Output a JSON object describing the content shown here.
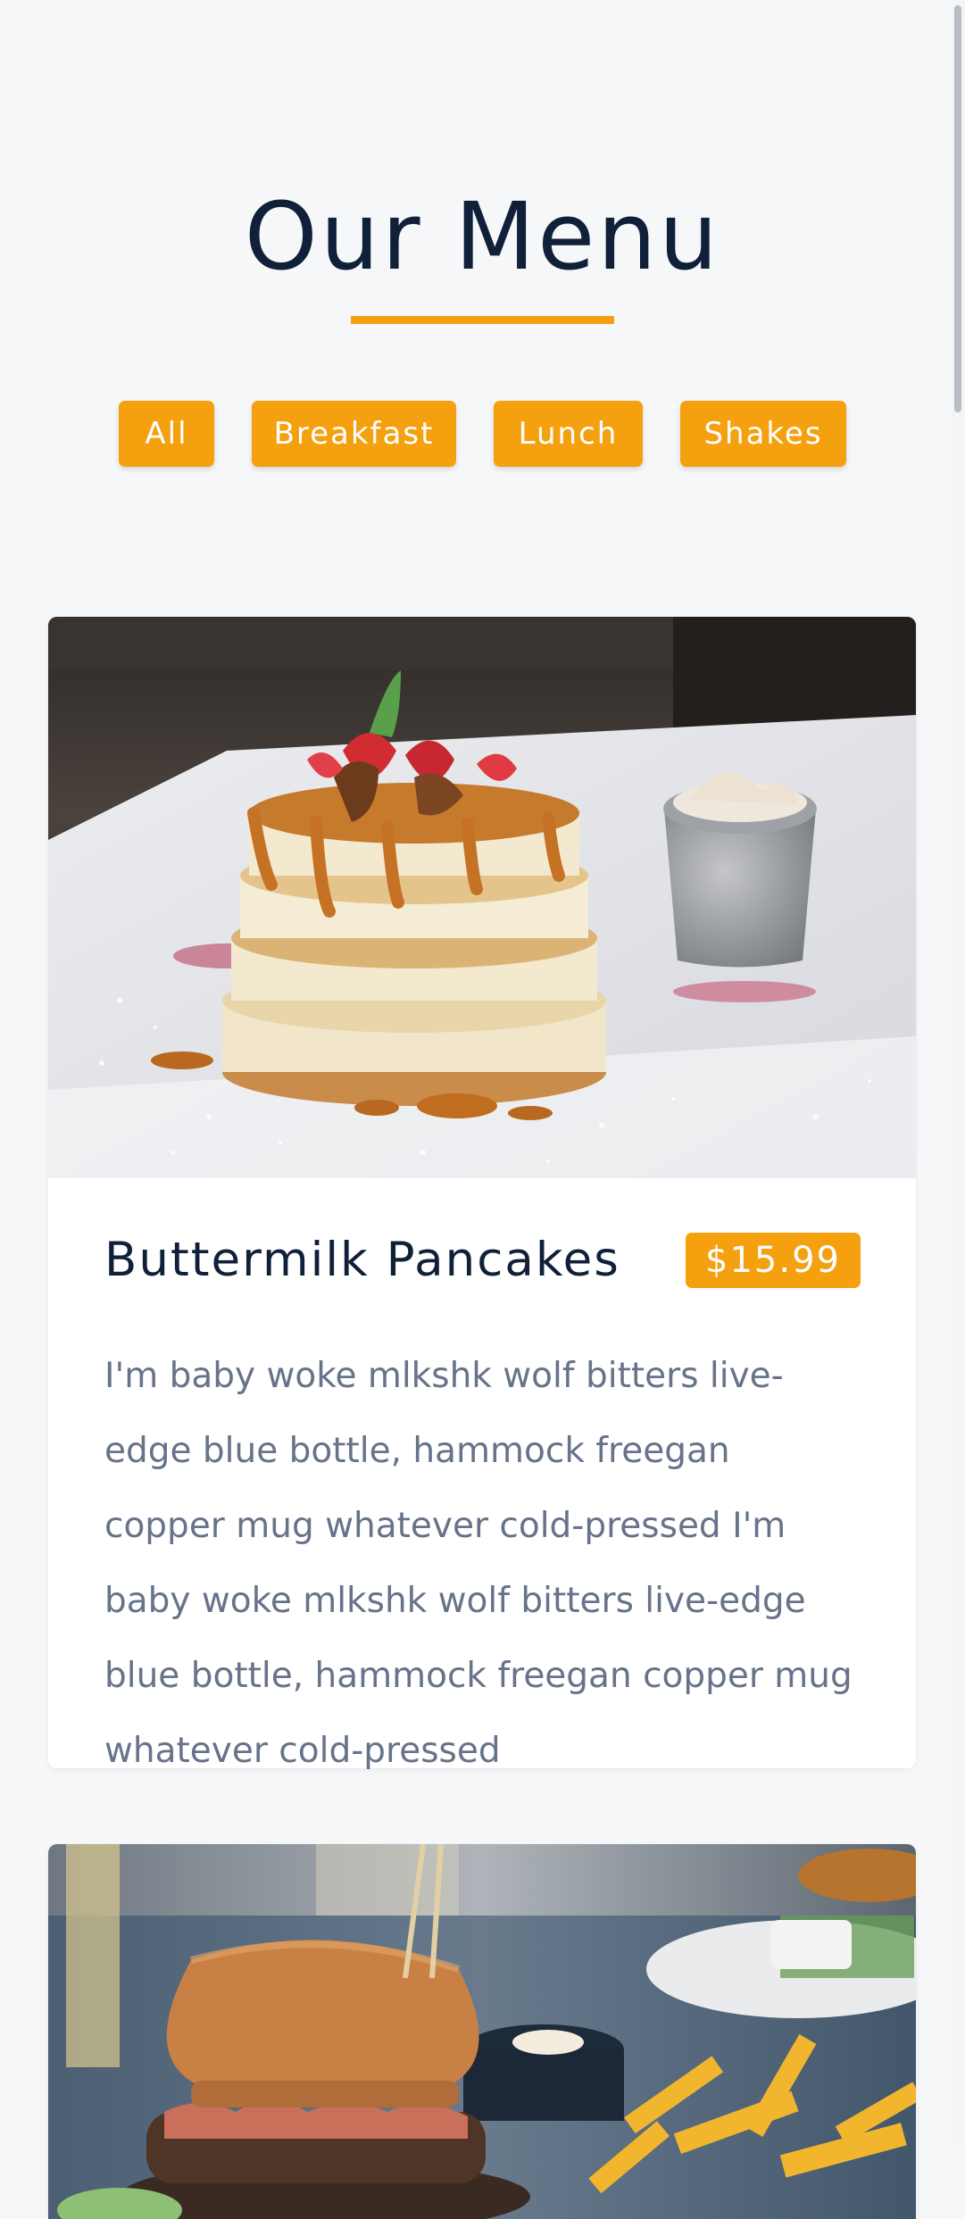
{
  "menu": {
    "title": "Our Menu",
    "accent_color": "#f5a00f",
    "filters": [
      {
        "label": "All"
      },
      {
        "label": "Breakfast"
      },
      {
        "label": "Lunch"
      },
      {
        "label": "Shakes"
      }
    ],
    "items": [
      {
        "name": "Buttermilk Pancakes",
        "price": "$15.99",
        "image": "pancake-stack-photo",
        "description": "I'm baby woke mlkshk wolf bitters live-edge blue bottle, hammock freegan copper mug whatever cold-pressed I'm baby woke mlkshk wolf bitters live-edge blue bottle, hammock freegan copper mug whatever cold-pressed"
      },
      {
        "image": "burger-and-fries-photo"
      }
    ]
  }
}
